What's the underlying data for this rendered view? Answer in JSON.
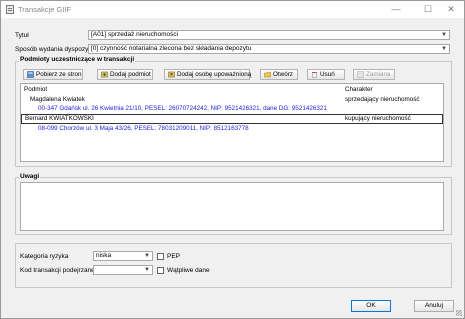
{
  "window": {
    "title": "Transakcje GIIF",
    "minimize": "—",
    "maximize": "☐",
    "close": "✕"
  },
  "form": {
    "tytul_label": "Tytuł",
    "tytul_value": "[A01] sprzedaż nieruchomości",
    "sposob_label": "Sposób wydania dyspozycji",
    "sposob_value": "[0] czynność notarialna zlecona bez składania depozytu"
  },
  "participants": {
    "group_title": "Podmioty uczestniczące w transakcji",
    "toolbar": {
      "fetch": "Pobierz ze stron",
      "add_entity": "Dodaj podmiot",
      "add_authorized": "Dodaj osobę upoważnioną",
      "open": "Otwórz",
      "delete": "Usuń",
      "change": "Zamiana"
    },
    "columns": {
      "entity": "Podmiot",
      "character": "Charakter"
    },
    "rows": [
      {
        "name": "Magdalena Kwiatek",
        "character": "sprzedający nieruchomość",
        "address": "00-347 Gdańsk ul. 26 Kwietnia 21/10, PESEL: 26070724242, NIP: 9521426321, dane DG: 9521426321"
      },
      {
        "name": "Bernard KWIATKOWSKI",
        "character": "kupujący nieruchomość",
        "address": "08-099 Chorzów ul. 3 Maja 43/26, PESEL: 78031209011, NIP: 8512163778"
      }
    ]
  },
  "remarks": {
    "title": "Uwagi"
  },
  "bottom": {
    "risk_label": "Kategoria ryzyka",
    "risk_value": "niska",
    "pep_label": "PEP",
    "code_label": "Kod transakcji podejrzanej",
    "code_value": "",
    "doubtful_label": "Wątpliwe dane"
  },
  "buttons": {
    "ok": "OK",
    "cancel": "Anuluj"
  },
  "colors": {
    "address_text": "#2222dd",
    "default_button_border": "#0078d7"
  }
}
